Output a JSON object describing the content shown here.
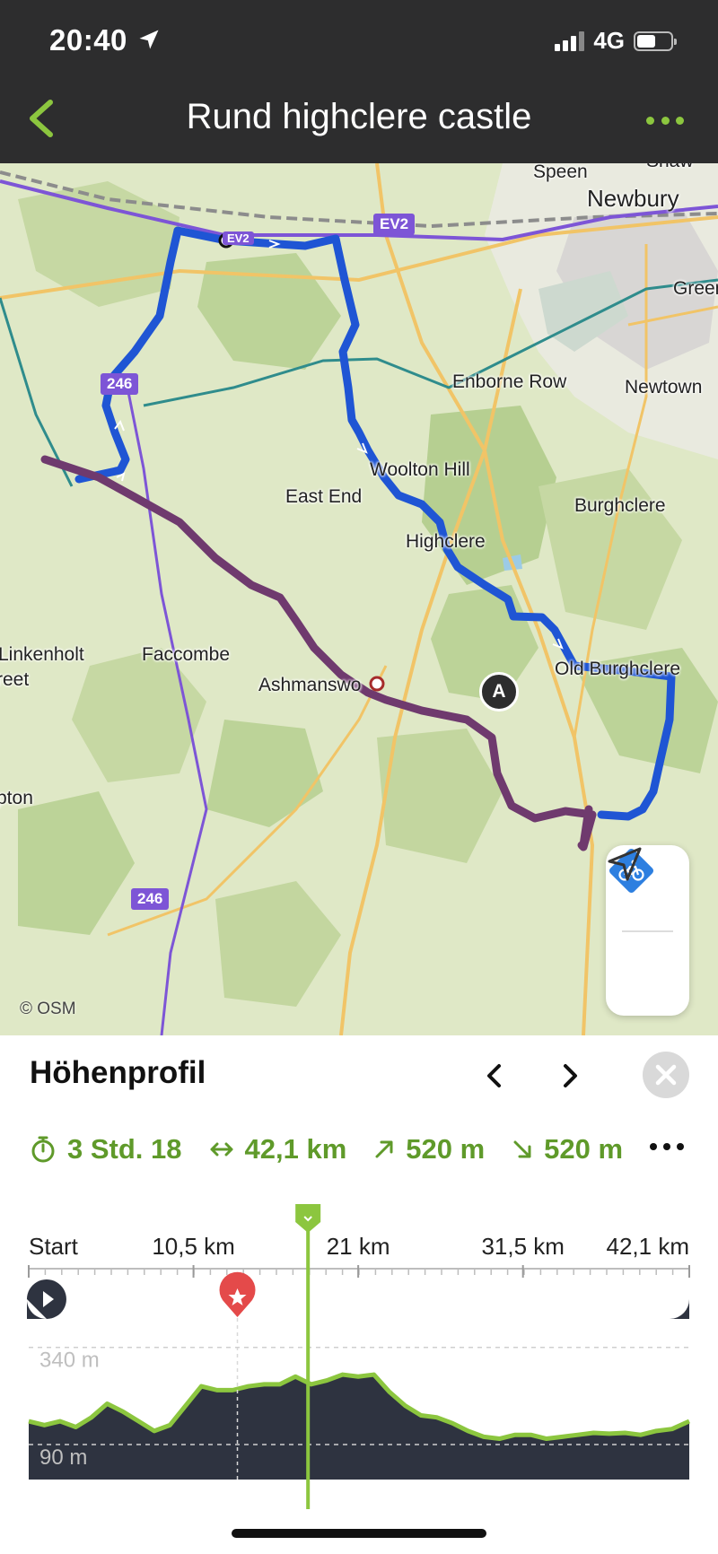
{
  "status_bar": {
    "time": "20:40",
    "network": "4G",
    "location_icon": "location-arrow-icon"
  },
  "header": {
    "title": "Rund highclere castle",
    "back_icon": "chevron-left-icon",
    "more_icon": "more-dots-icon",
    "accent_color": "#8cc63f"
  },
  "map": {
    "places": [
      {
        "id": "speen",
        "label": "Speen"
      },
      {
        "id": "shaw",
        "label": "Shaw"
      },
      {
        "id": "newbury",
        "label": "Newbury"
      },
      {
        "id": "green",
        "label": "Green"
      },
      {
        "id": "enborne",
        "label": "Enborne Row"
      },
      {
        "id": "newtown",
        "label": "Newtown"
      },
      {
        "id": "woolton",
        "label": "Woolton Hill"
      },
      {
        "id": "eastend",
        "label": "East End"
      },
      {
        "id": "burghclere",
        "label": "Burghclere"
      },
      {
        "id": "highclere",
        "label": "Highclere"
      },
      {
        "id": "linkenholt",
        "label": "Linkenholt"
      },
      {
        "id": "reet",
        "label": "reet"
      },
      {
        "id": "faccombe",
        "label": "Faccombe"
      },
      {
        "id": "ashmansworth",
        "label": "Ashmanswo"
      },
      {
        "id": "oldburghclere",
        "label": "Old Burghclere"
      },
      {
        "id": "upton",
        "label": "pton"
      }
    ],
    "road_badges": {
      "ev2": "EV2",
      "r246a": "246",
      "r246b": "246",
      "ev2b": "EV2"
    },
    "attribution": "© OSM",
    "marker_a": "A",
    "route_color_outbound": "#1f55d4",
    "route_color_return": "#6f3a6e",
    "bike_button_icon": "bicycle-icon",
    "locate_button_icon": "navigation-arrow-icon"
  },
  "elevation_panel": {
    "title": "Höhenprofil",
    "stats": {
      "duration": "3 Std. 18",
      "distance": "42,1 km",
      "ascent": "520 m",
      "descent": "520 m"
    },
    "stat_icons": [
      "stopwatch-icon",
      "distance-arrows-icon",
      "ascent-arrow-icon",
      "descent-arrow-icon"
    ],
    "chart_data": {
      "type": "area",
      "x_tick_labels": [
        "Start",
        "10,5 km",
        "21 km",
        "31,5 km",
        "42,1 km"
      ],
      "x_ticks_km": [
        0,
        10.5,
        21,
        31.5,
        42.1
      ],
      "y_reference_lines": [
        {
          "label": "340 m",
          "value": 340
        },
        {
          "label": "90 m",
          "value": 90
        }
      ],
      "x": [
        0,
        1,
        2,
        3,
        4,
        5,
        6,
        7,
        8,
        9,
        10,
        11,
        12,
        13,
        14,
        15,
        16,
        17,
        18,
        19,
        20,
        21,
        22,
        23,
        24,
        25,
        26,
        27,
        28,
        29,
        30,
        31,
        32,
        33,
        34,
        35,
        36,
        37,
        38,
        39,
        40,
        41,
        42.1
      ],
      "elevation_m": [
        150,
        140,
        150,
        135,
        160,
        195,
        175,
        150,
        125,
        140,
        190,
        240,
        230,
        230,
        240,
        245,
        245,
        265,
        245,
        255,
        270,
        265,
        270,
        225,
        190,
        165,
        160,
        145,
        125,
        110,
        105,
        115,
        115,
        105,
        110,
        115,
        120,
        118,
        120,
        115,
        125,
        130,
        150
      ],
      "current_position_km": 17.8,
      "waypoint_km": 13.3,
      "fill_color": "#2e3340",
      "line_color": "#8cc63f"
    },
    "marker_icons": [
      "start-play-icon",
      "waypoint-star-icon",
      "finish-flag-icon"
    ]
  }
}
